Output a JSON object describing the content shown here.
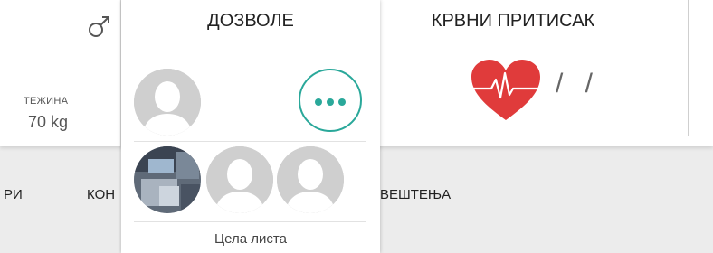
{
  "vitals": {
    "weight_label": "ТЕЖИНА",
    "weight_value": "70 kg",
    "gender_icon": "male-symbol-icon"
  },
  "blood_pressure": {
    "title": "КРВНИ ПРИТИСАК",
    "value": "/ /",
    "icon": "heart-pulse-icon"
  },
  "permissions_panel": {
    "title": "ДОЗВОЛЕ",
    "more_icon": "more-dots-icon",
    "full_list_label": "Цела листа"
  },
  "nav": {
    "item_1": "РИ",
    "item_2": "КОН",
    "item_3": "ВЕШТЕЊА"
  },
  "colors": {
    "accent": "#2aa89a",
    "heart": "#e03b3b",
    "background": "#ececec",
    "placeholder_avatar": "#cfcfcf"
  }
}
